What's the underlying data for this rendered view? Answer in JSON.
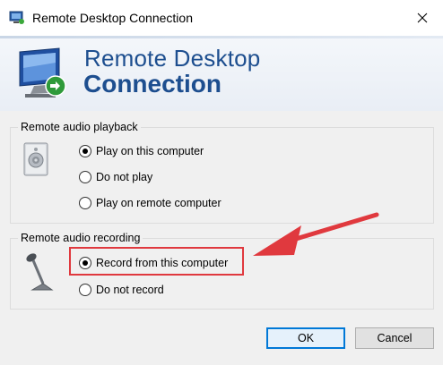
{
  "window": {
    "title": "Remote Desktop Connection",
    "icon": "remote-desktop-icon",
    "close_icon": "close-icon"
  },
  "banner": {
    "line1": "Remote Desktop",
    "line2": "Connection",
    "logo_icon": "remote-desktop-monitor-icon"
  },
  "playback": {
    "legend": "Remote audio playback",
    "icon": "speaker-icon",
    "options": [
      {
        "label": "Play on this computer",
        "checked": true
      },
      {
        "label": "Do not play",
        "checked": false
      },
      {
        "label": "Play on remote computer",
        "checked": false
      }
    ]
  },
  "recording": {
    "legend": "Remote audio recording",
    "icon": "microphone-icon",
    "options": [
      {
        "label": "Record from this computer",
        "checked": true
      },
      {
        "label": "Do not record",
        "checked": false
      }
    ]
  },
  "annotation": {
    "highlight_color": "#e0393e",
    "arrow_icon": "red-arrow-icon"
  },
  "buttons": {
    "ok": "OK",
    "cancel": "Cancel"
  },
  "colors": {
    "banner_text": "#1d4e8f",
    "dialog_bg": "#f0f0f0",
    "focus_border": "#0078d7"
  }
}
